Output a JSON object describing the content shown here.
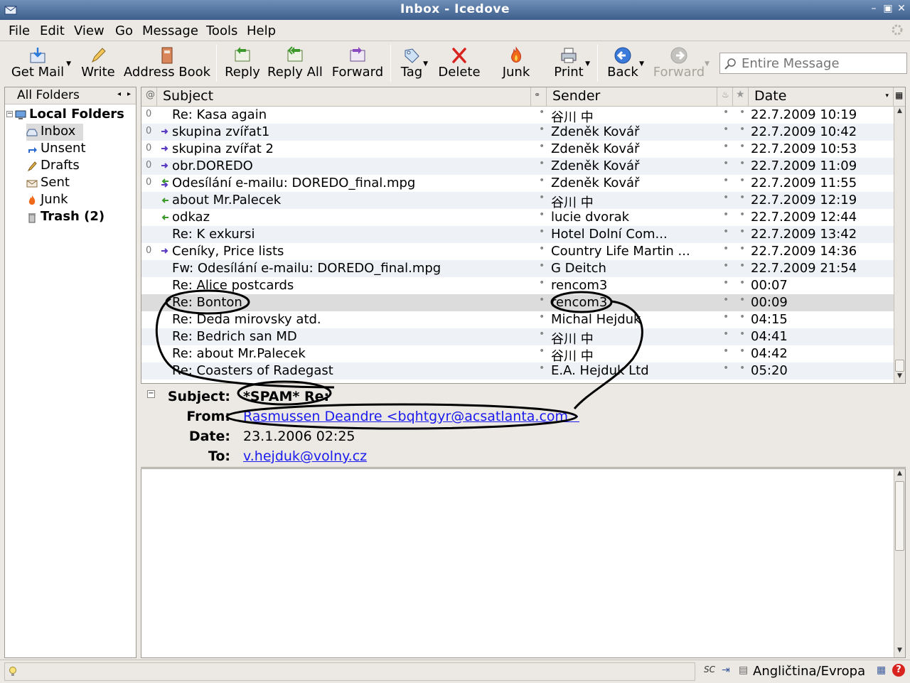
{
  "window": {
    "title": "Inbox - Icedove"
  },
  "menu": [
    "File",
    "Edit",
    "View",
    "Go",
    "Message",
    "Tools",
    "Help"
  ],
  "toolbar": {
    "get_mail": "Get Mail",
    "write": "Write",
    "address_book": "Address Book",
    "reply": "Reply",
    "reply_all": "Reply All",
    "forward": "Forward",
    "tag": "Tag",
    "delete": "Delete",
    "junk": "Junk",
    "print": "Print",
    "back": "Back",
    "forward_nav": "Forward"
  },
  "search": {
    "placeholder": "Entire Message"
  },
  "folders": {
    "header": "All Folders",
    "root": "Local Folders",
    "items": [
      {
        "label": "Inbox",
        "icon": "inbox-icon"
      },
      {
        "label": "Unsent",
        "icon": "unsent-icon"
      },
      {
        "label": "Drafts",
        "icon": "drafts-icon"
      },
      {
        "label": "Sent",
        "icon": "sent-icon"
      },
      {
        "label": "Junk",
        "icon": "junk-icon"
      },
      {
        "label": "Trash (2)",
        "icon": "trash-icon"
      }
    ]
  },
  "columns": {
    "subject": "Subject",
    "sender": "Sender",
    "date": "Date"
  },
  "messages": [
    {
      "subject": "Re: Kasa again",
      "sender": "谷川     中",
      "date": "22.7.2009 10:19"
    },
    {
      "subject": "skupina zvířat1",
      "sender": "Zdeněk Kovář",
      "date": "22.7.2009 10:42"
    },
    {
      "subject": "skupina zvířat 2",
      "sender": "Zdeněk Kovář",
      "date": "22.7.2009 10:53"
    },
    {
      "subject": "obr.DOREDO",
      "sender": "Zdeněk Kovář",
      "date": "22.7.2009 11:09"
    },
    {
      "subject": "Odesílání e-mailu: DOREDO_final.mpg",
      "sender": "Zdeněk Kovář",
      "date": "22.7.2009 11:55"
    },
    {
      "subject": "about Mr.Palecek",
      "sender": "谷川     中",
      "date": "22.7.2009 12:19"
    },
    {
      "subject": "odkaz",
      "sender": "lucie dvorak",
      "date": "22.7.2009 12:44"
    },
    {
      "subject": "Re: K exkursi",
      "sender": "Hotel      Dolní Com...",
      "date": "22.7.2009 13:42"
    },
    {
      "subject": "Ceníky, Price lists",
      "sender": "Country Life    Martin ...",
      "date": "22.7.2009 14:36"
    },
    {
      "subject": "Fw: Odesílání e-mailu: DOREDO_final.mpg",
      "sender": "G      Deitch",
      "date": "22.7.2009 21:54"
    },
    {
      "subject": "Re: Alice postcards",
      "sender": "rencom3",
      "date": "00:07"
    },
    {
      "subject": "Re: Bonton",
      "sender": "rencom3",
      "date": "00:09"
    },
    {
      "subject": "Re: Deda mirovsky atd.",
      "sender": "Michal Hejduk",
      "date": "04:15"
    },
    {
      "subject": "Re: Bedrich san MD",
      "sender": "谷川     中",
      "date": "04:41"
    },
    {
      "subject": "Re: about Mr.Palecek",
      "sender": "谷川     中",
      "date": "04:42"
    },
    {
      "subject": "Re: Coasters of Radegast",
      "sender": "E.A. Hejduk Ltd",
      "date": "05:20"
    }
  ],
  "header_pane": {
    "subject_label": "Subject:",
    "subject_value": "*SPAM* Re:",
    "from_label": "From:",
    "from_value": "Rasmussen Deandre <bqhtgyr@acsatlanta.com>",
    "date_label": "Date:",
    "date_value": "23.1.2006 02:25",
    "to_label": "To:",
    "to_value": "v.hejduk@volny.cz"
  },
  "status": {
    "keyboard_layout": "Angličtina/Evropa"
  },
  "colors": {
    "titlebar": "#3e5f8c",
    "link": "#1a1aee",
    "selection": "#dcdcdc",
    "row_alt": "#eef2f7"
  }
}
